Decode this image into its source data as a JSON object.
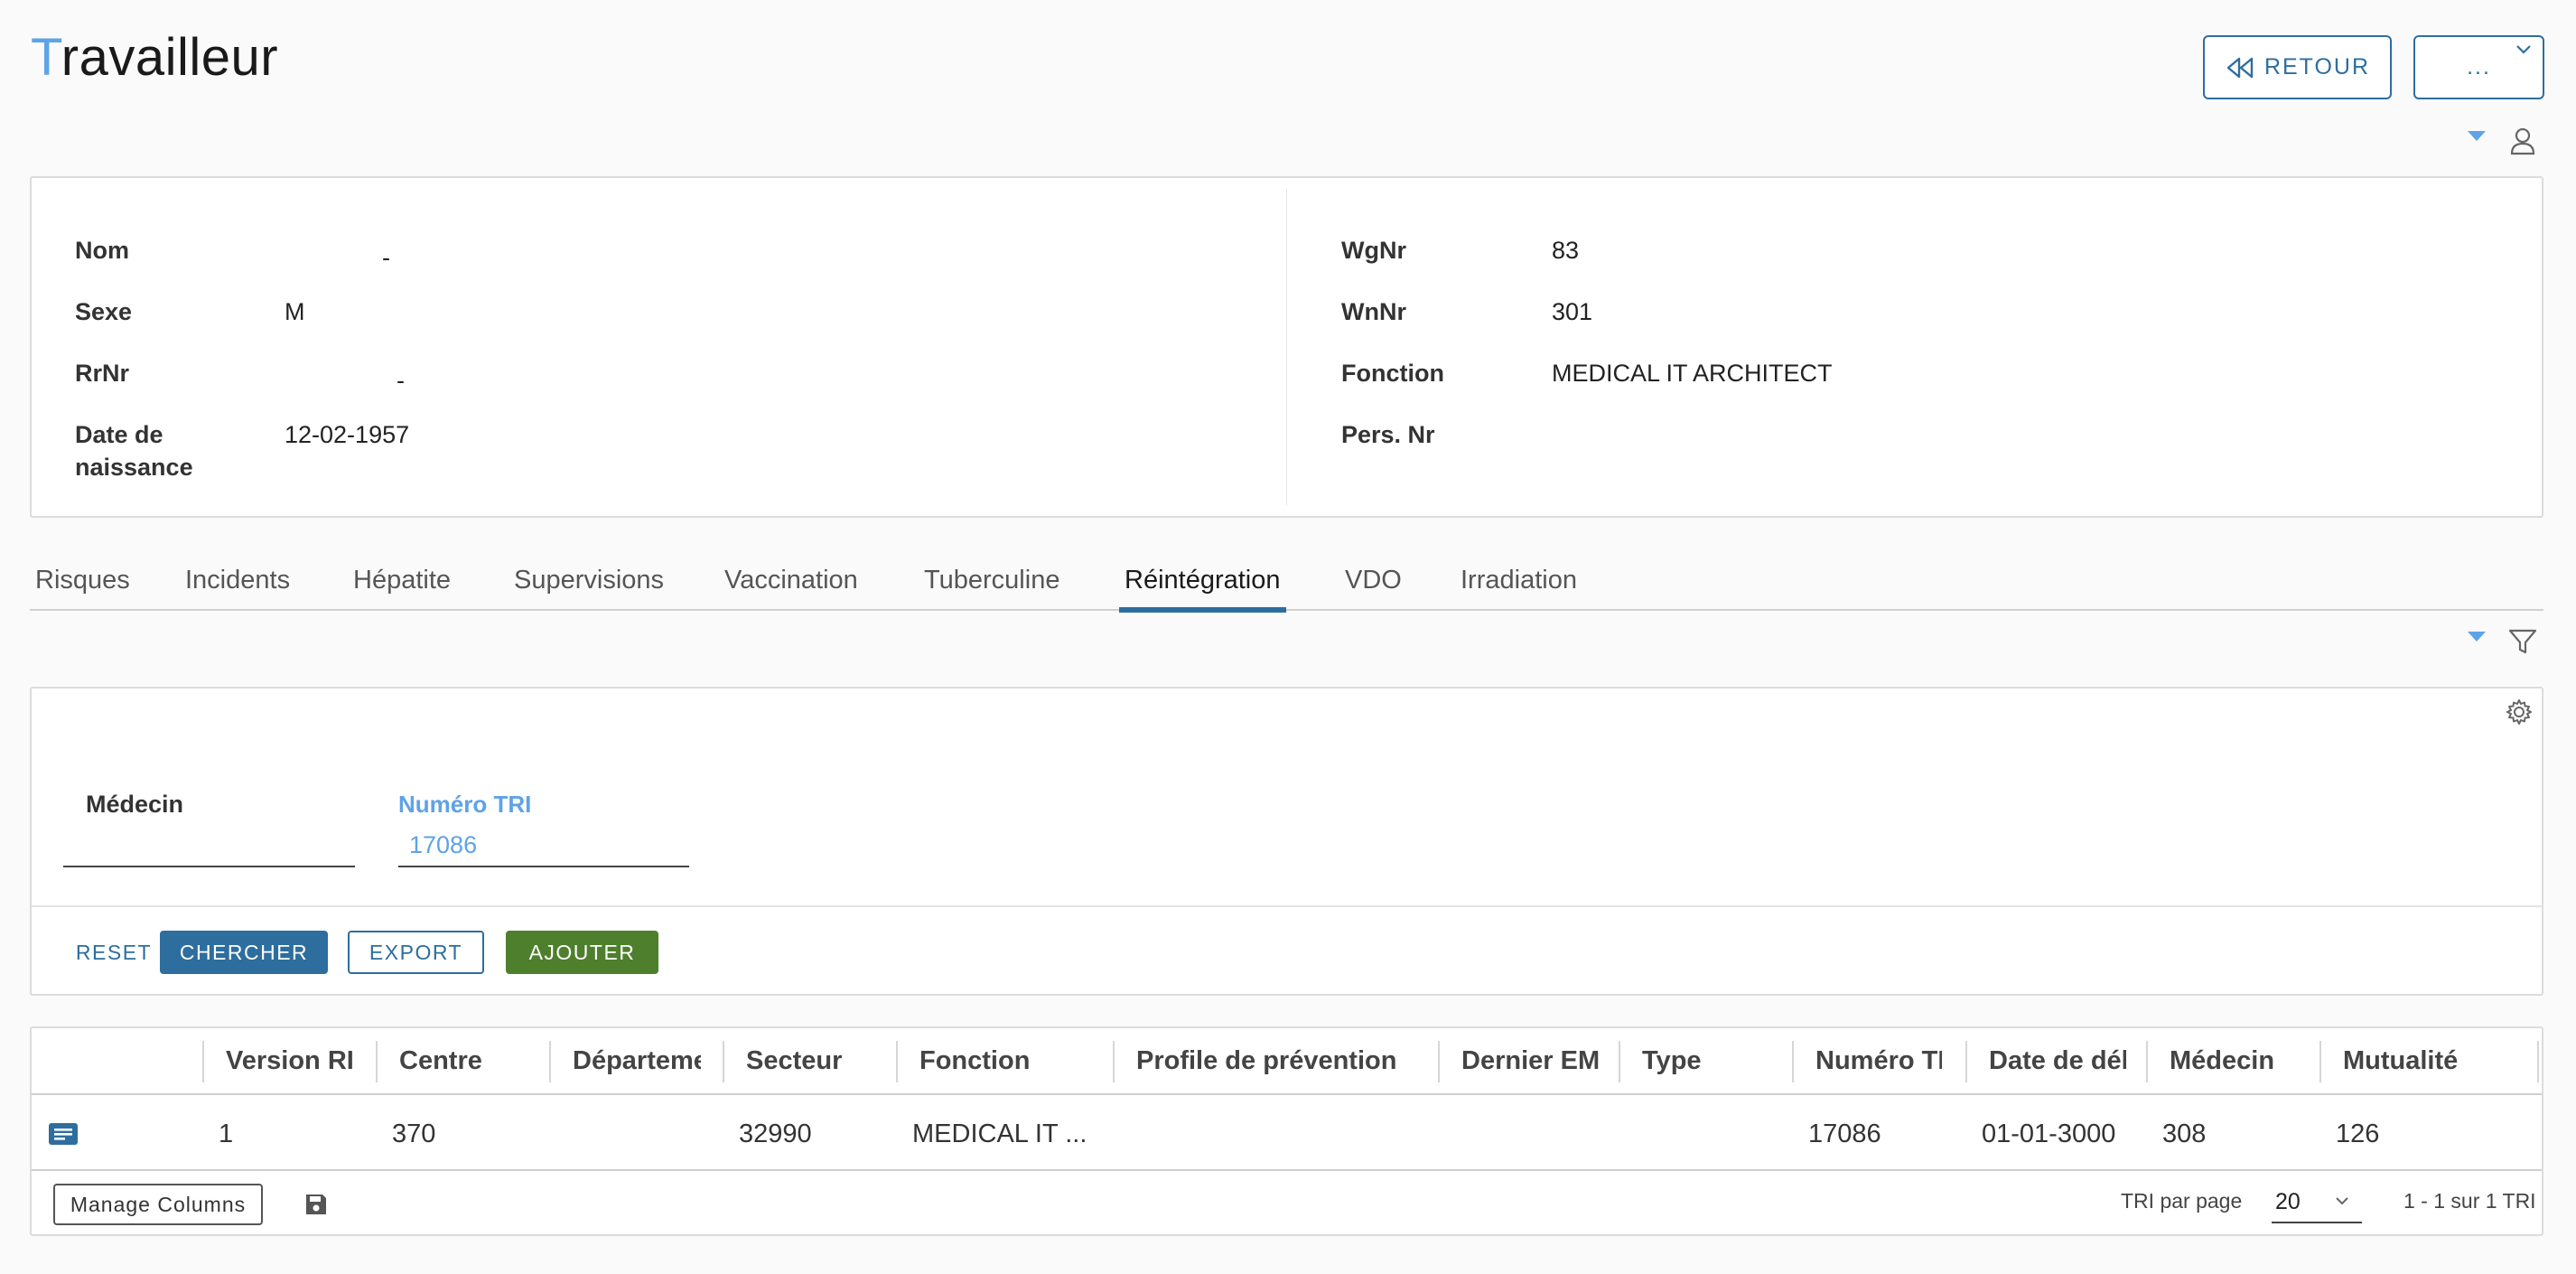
{
  "header": {
    "title_first": "T",
    "title_rest": "ravailleur",
    "back_label": "RETOUR",
    "more_label": "..."
  },
  "worker": {
    "left": [
      {
        "label": "Nom",
        "value": "-"
      },
      {
        "label": "Sexe",
        "value": "M"
      },
      {
        "label": "RrNr",
        "value": "-"
      },
      {
        "label": "Date de naissance",
        "value": "12-02-1957"
      }
    ],
    "right": [
      {
        "label": "WgNr",
        "value": "83"
      },
      {
        "label": "WnNr",
        "value": "301"
      },
      {
        "label": "Fonction",
        "value": "MEDICAL IT ARCHITECT"
      },
      {
        "label": "Pers. Nr",
        "value": ""
      }
    ]
  },
  "tabs": [
    "Risques",
    "Incidents",
    "Hépatite",
    "Supervisions",
    "Vaccination",
    "Tuberculine",
    "Réintégration",
    "VDO",
    "Irradiation"
  ],
  "active_tab": "Réintégration",
  "filters": {
    "medecin_label": "Médecin",
    "medecin_value": "",
    "numero_label": "Numéro TRI",
    "numero_value": "17086"
  },
  "actions": {
    "reset": "RESET",
    "search": "CHERCHER",
    "export": "EXPORT",
    "add": "AJOUTER"
  },
  "grid": {
    "columns": [
      "Version RI",
      "Centre",
      "Département",
      "Secteur",
      "Fonction",
      "Profile de prévention",
      "Dernier EM",
      "Type",
      "Numéro TRI",
      "Date de début",
      "Médecin",
      "Mutualité"
    ],
    "rows": [
      [
        "1",
        "370",
        "",
        "32990",
        "MEDICAL IT ...",
        "",
        "",
        "",
        "17086",
        "01-01-3000",
        "308",
        "126"
      ]
    ],
    "manage_columns": "Manage Columns",
    "per_page_label": "TRI par page",
    "per_page_value": "20",
    "range_text": "1 - 1 sur 1 TRI"
  },
  "colors": {
    "accent": "#2d6e9e",
    "title_accent": "#5ea3e8",
    "add_button": "#4e7f2c"
  }
}
